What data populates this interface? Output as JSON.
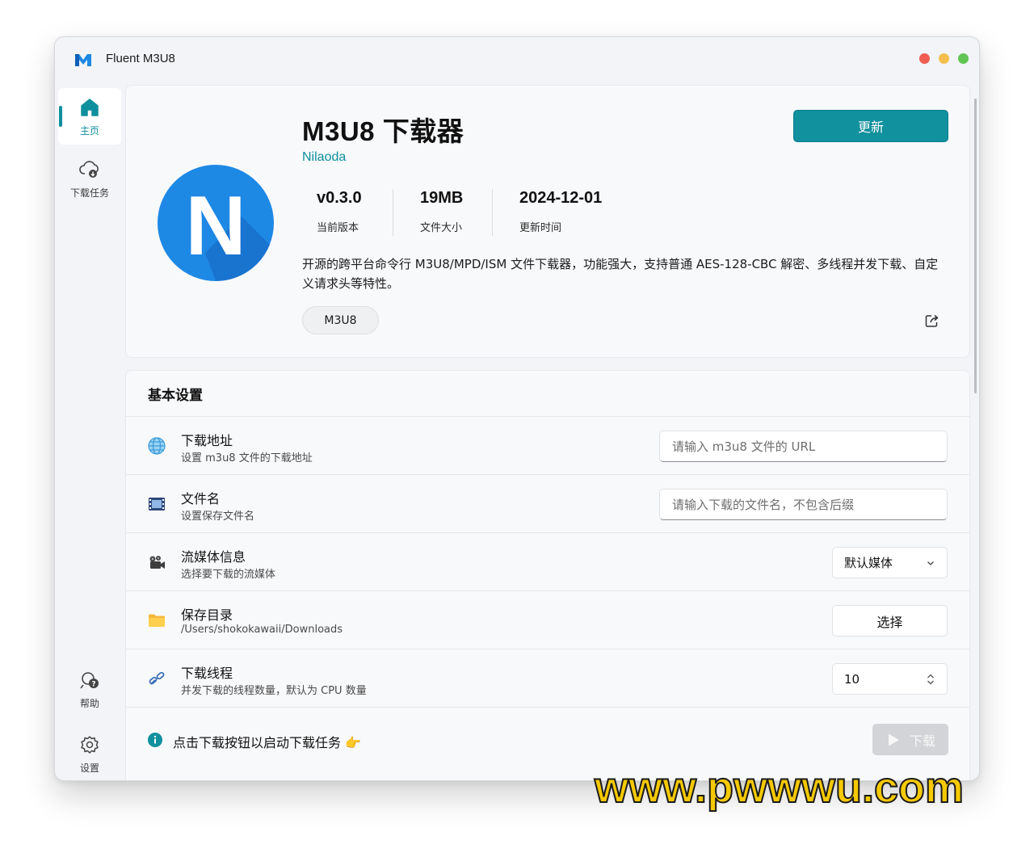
{
  "window": {
    "title": "Fluent M3U8"
  },
  "nav": {
    "home_label": "主页",
    "tasks_label": "下载任务",
    "help_label": "帮助",
    "settings_label": "设置"
  },
  "hero": {
    "logo_letter": "N",
    "title": "M3U8 下载器",
    "author": "Nilaoda",
    "update_label": "更新",
    "stats": [
      {
        "value": "v0.3.0",
        "label": "当前版本"
      },
      {
        "value": "19MB",
        "label": "文件大小"
      },
      {
        "value": "2024-12-01",
        "label": "更新时间"
      }
    ],
    "description": "开源的跨平台命令行 M3U8/MPD/ISM 文件下载器，功能强大，支持普通 AES-128-CBC 解密、多线程并发下载、自定义请求头等特性。",
    "tag": "M3U8"
  },
  "settings": {
    "section_title": "基本设置",
    "url": {
      "title": "下载地址",
      "subtitle": "设置 m3u8 文件的下载地址",
      "placeholder": "请输入 m3u8 文件的 URL"
    },
    "filename": {
      "title": "文件名",
      "subtitle": "设置保存文件名",
      "placeholder": "请输入下载的文件名，不包含后缀"
    },
    "stream": {
      "title": "流媒体信息",
      "subtitle": "选择要下载的流媒体",
      "selected": "默认媒体"
    },
    "folder": {
      "title": "保存目录",
      "subtitle": "/Users/shokokawaii/Downloads",
      "button": "选择"
    },
    "threads": {
      "title": "下载线程",
      "subtitle": "并发下载的线程数量，默认为 CPU 数量",
      "value": "10"
    },
    "hint": "点击下载按钮以启动下载任务 👉",
    "download_label": "下载"
  },
  "watermark": "www.pwwwu.com",
  "colors": {
    "accent": "#11909e",
    "brand_blue": "#1e88e5",
    "disabled": "#d2d4d7"
  }
}
